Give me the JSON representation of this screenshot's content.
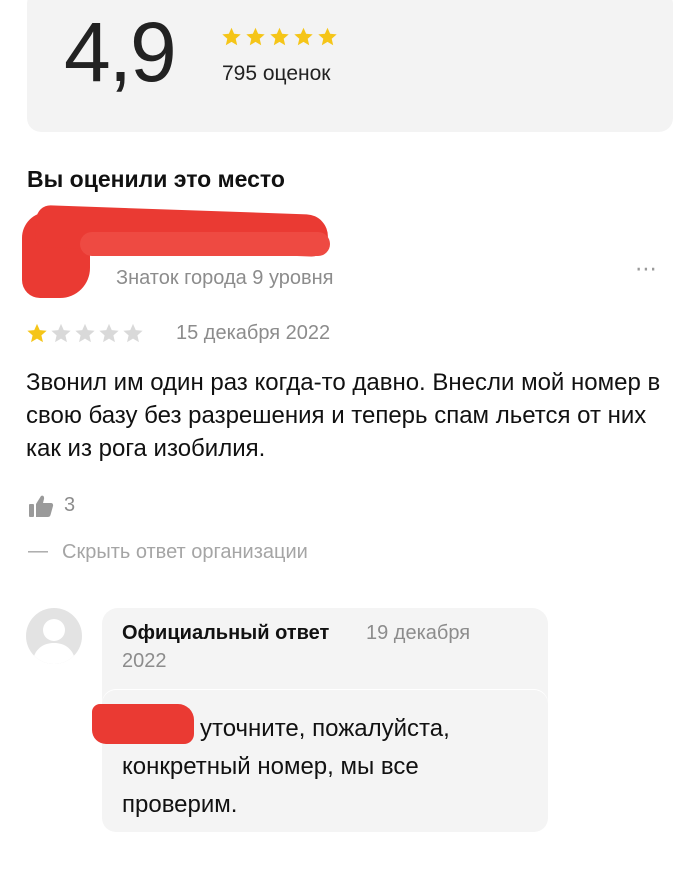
{
  "rating": {
    "score": "4,9",
    "stars": 5,
    "star_color": "#f5c518",
    "count_text": "795 оценок"
  },
  "your_review_section": {
    "title": "Вы оценили это место"
  },
  "review": {
    "user_level": "Знаток города 9 уровня",
    "more_icon": "⋯",
    "rating": 1,
    "star_filled_color": "#f5c518",
    "star_empty_color": "#d9d9d9",
    "date": "15 декабря 2022",
    "text": "Звонил им один раз когда-то давно. Внесли мой номер в свою базу без разрешения и теперь спам льется от них как из рога изобилия.",
    "likes": "3",
    "hide_dash": "—",
    "hide_link": "Скрыть ответ организации"
  },
  "org_reply": {
    "title": "Официальный ответ",
    "date_part1": "19 декабря",
    "date_part2": "2022",
    "text": "уточните, пожалуйста, конкретный номер, мы все проверим.",
    "redaction_color": "#ea3a33"
  }
}
